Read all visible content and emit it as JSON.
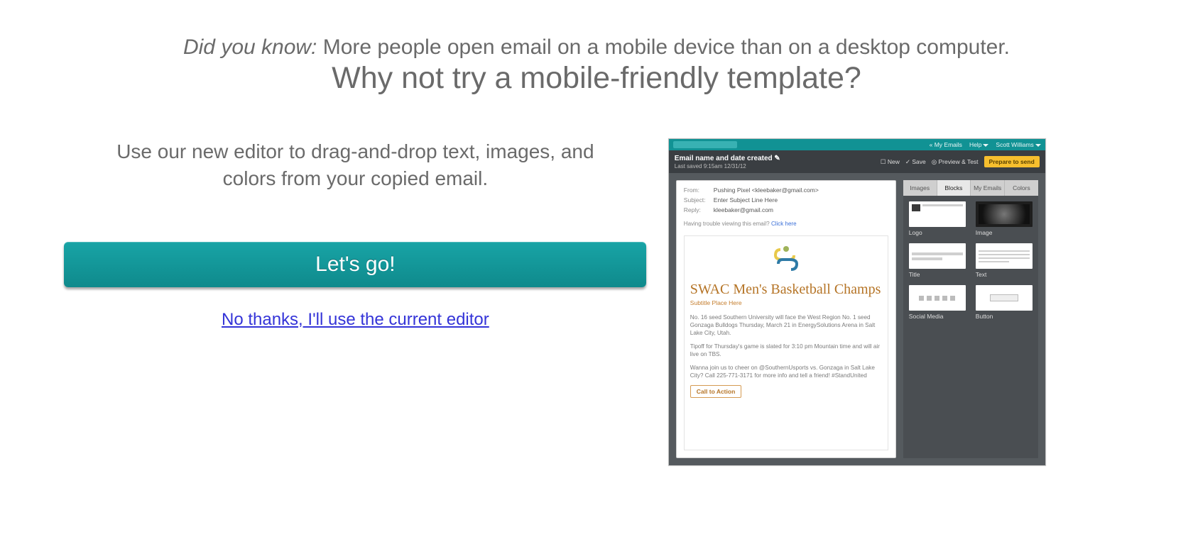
{
  "header": {
    "intro_prefix": "Did you know:",
    "intro_rest": " More people open email on a mobile device than on a desktop computer.",
    "headline": "Why not try a mobile-friendly template?"
  },
  "left": {
    "sub_line1": "Use our new editor to drag-and-drop text, images, and",
    "sub_line2": "colors from your copied email.",
    "cta_label": "Let's go!",
    "decline_label": "No thanks, I'll use the current editor"
  },
  "preview": {
    "topbar": {
      "my_emails": "« My Emails",
      "help": "Help",
      "user": "Scott Williams"
    },
    "titlebar": {
      "title": "Email name and date created",
      "saved": "Last saved 9:15am 12/31/12",
      "actions": {
        "new": "New",
        "save": "Save",
        "preview": "Preview & Test",
        "prepare": "Prepare to send"
      }
    },
    "fields": {
      "from_label": "From:",
      "from_value": "Pushing Pixel <kleebaker@gmail.com>",
      "subject_label": "Subject:",
      "subject_value": "Enter Subject Line Here",
      "reply_label": "Reply:",
      "reply_value": "kleebaker@gmail.com",
      "trouble_text": "Having trouble viewing this email? ",
      "trouble_link": "Click here"
    },
    "article": {
      "headline": "SWAC Men's Basketball Champs",
      "subtitle": "Subtitle Place Here",
      "p1": "No. 16 seed Southern University will face the West Region No. 1 seed Gonzaga Bulldogs Thursday, March 21 in EnergySolutions Arena in Salt Lake City, Utah.",
      "p2": "Tipoff for Thursday's game is slated for 3:10 pm Mountain time and will air live on TBS.",
      "p3": "Wanna join us to cheer on @SouthernUsports vs. Gonzaga in Salt Lake City? Call 225-771-3171 for more info and tell a friend! #StandUnited",
      "cta": "Call to Action"
    },
    "side": {
      "tabs": {
        "images": "Images",
        "blocks": "Blocks",
        "my_emails": "My Emails",
        "colors": "Colors"
      },
      "items": {
        "logo": "Logo",
        "image": "Image",
        "title": "Title",
        "text": "Text",
        "social": "Social Media",
        "button": "Button"
      }
    }
  }
}
